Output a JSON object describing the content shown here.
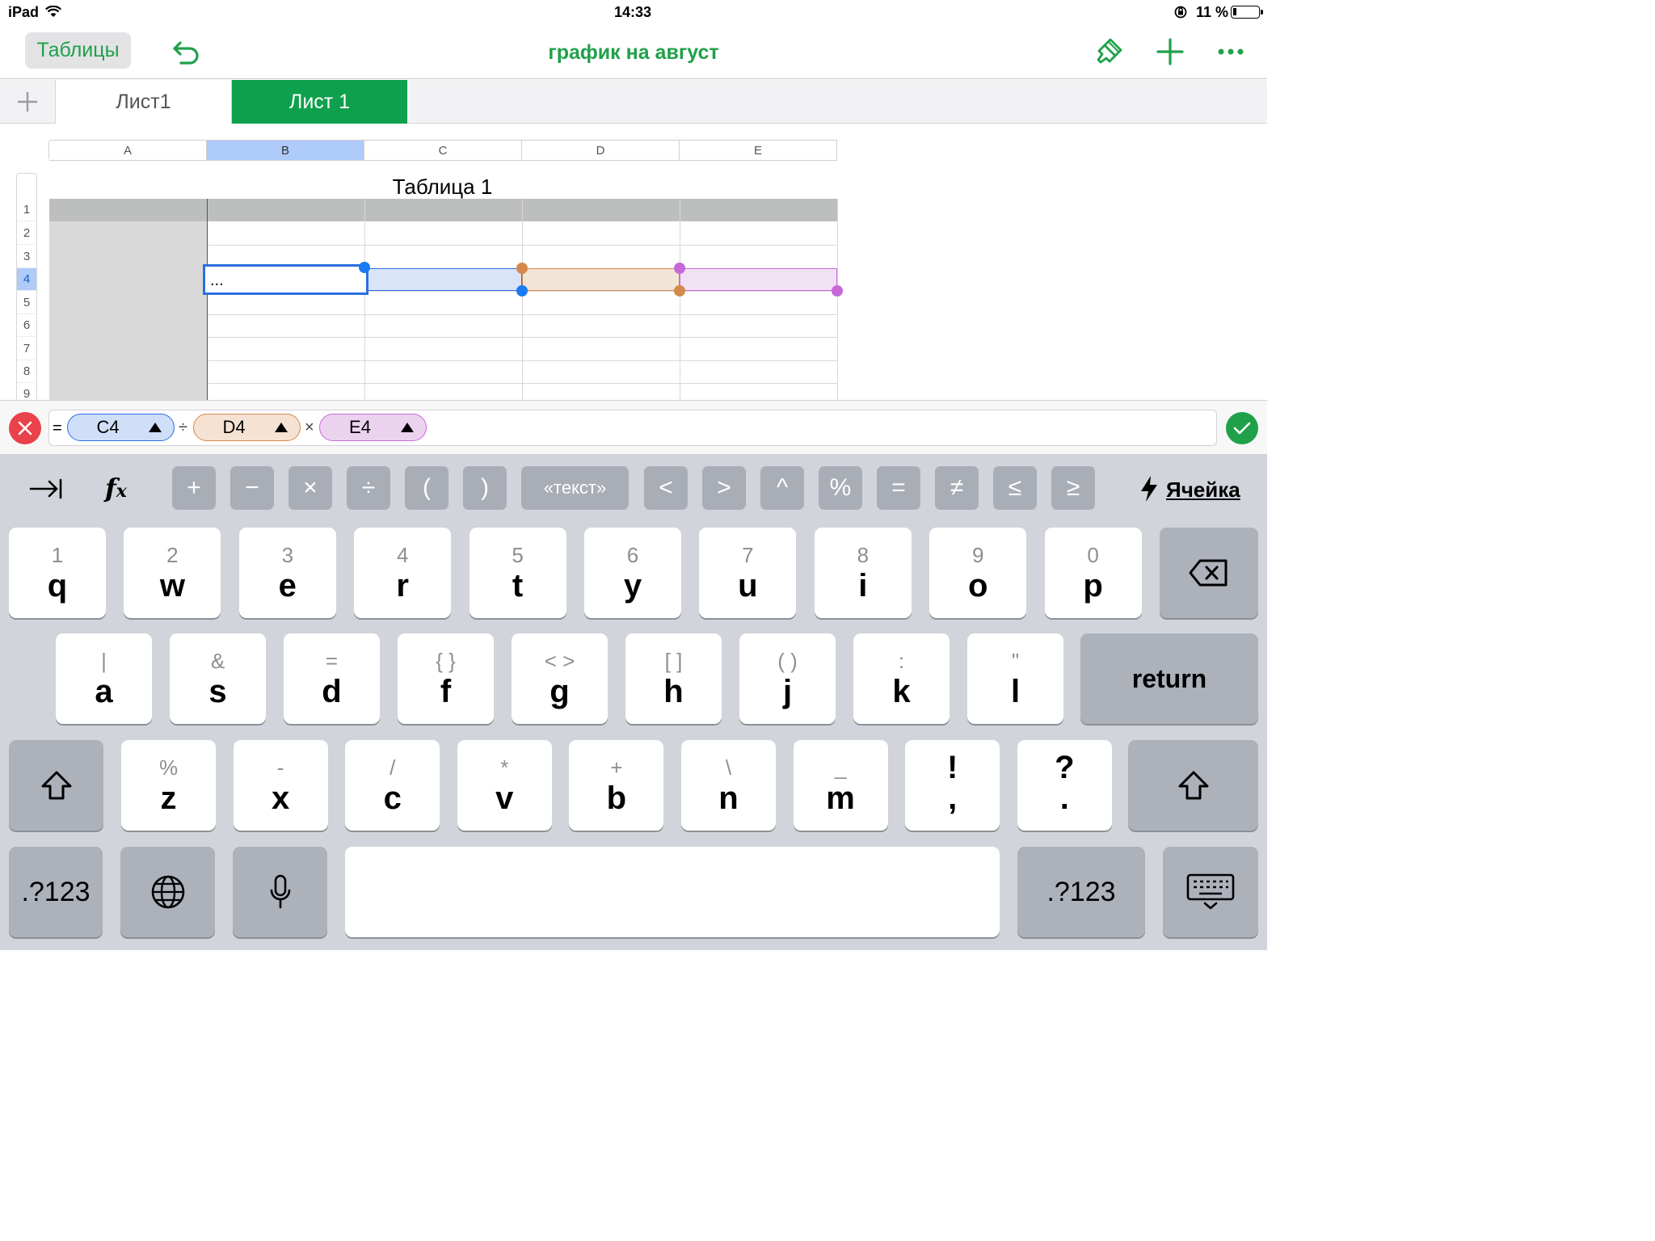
{
  "status": {
    "device": "iPad",
    "time": "14:33",
    "battery": "11 %"
  },
  "toolbar": {
    "back_label": "Таблицы",
    "doc_title": "график на  август"
  },
  "tabs": [
    {
      "label": "Лист1"
    },
    {
      "label": "Лист 1"
    }
  ],
  "sheet": {
    "columns": [
      "A",
      "B",
      "C",
      "D",
      "E"
    ],
    "rows": [
      "1",
      "2",
      "3",
      "4",
      "5",
      "6",
      "7",
      "8",
      "9"
    ],
    "table_title": "Таблица 1",
    "active_cell_value": "..."
  },
  "formula": {
    "eq": "=",
    "tokens": [
      {
        "ref": "C4",
        "op": "÷"
      },
      {
        "ref": "D4",
        "op": "×"
      },
      {
        "ref": "E4",
        "op": ""
      }
    ]
  },
  "func_row": [
    "+",
    "−",
    "×",
    "÷",
    "(",
    ")",
    "«текст»",
    "<",
    ">",
    "^",
    "%",
    "=",
    "≠",
    "≤",
    "≥"
  ],
  "cell_label": "Ячейка",
  "keyboard": {
    "row1": [
      {
        "s": "1",
        "m": "q"
      },
      {
        "s": "2",
        "m": "w"
      },
      {
        "s": "3",
        "m": "e"
      },
      {
        "s": "4",
        "m": "r"
      },
      {
        "s": "5",
        "m": "t"
      },
      {
        "s": "6",
        "m": "y"
      },
      {
        "s": "7",
        "m": "u"
      },
      {
        "s": "8",
        "m": "i"
      },
      {
        "s": "9",
        "m": "o"
      },
      {
        "s": "0",
        "m": "p"
      }
    ],
    "row2": [
      {
        "s": "|",
        "m": "a"
      },
      {
        "s": "&",
        "m": "s"
      },
      {
        "s": "=",
        "m": "d"
      },
      {
        "s": "{   }",
        "m": "f"
      },
      {
        "s": "<   >",
        "m": "g"
      },
      {
        "s": "[   ]",
        "m": "h"
      },
      {
        "s": "(   )",
        "m": "j"
      },
      {
        "s": ":",
        "m": "k"
      },
      {
        "s": "\"",
        "m": "l"
      }
    ],
    "row3": [
      {
        "s": "%",
        "m": "z"
      },
      {
        "s": "-",
        "m": "x"
      },
      {
        "s": "/",
        "m": "c"
      },
      {
        "s": "*",
        "m": "v"
      },
      {
        "s": "+",
        "m": "b"
      },
      {
        "s": "\\",
        "m": "n"
      },
      {
        "s": "_",
        "m": "m"
      },
      {
        "s": "!",
        "m": ","
      },
      {
        "s": "?",
        "m": "."
      }
    ],
    "return_label": "return",
    "numbers_label": ".?123"
  },
  "colors": {
    "accent": "#1fa14a",
    "c_ref": "#1a7cf0",
    "d_ref": "#d4894a",
    "e_ref": "#c768d9"
  }
}
